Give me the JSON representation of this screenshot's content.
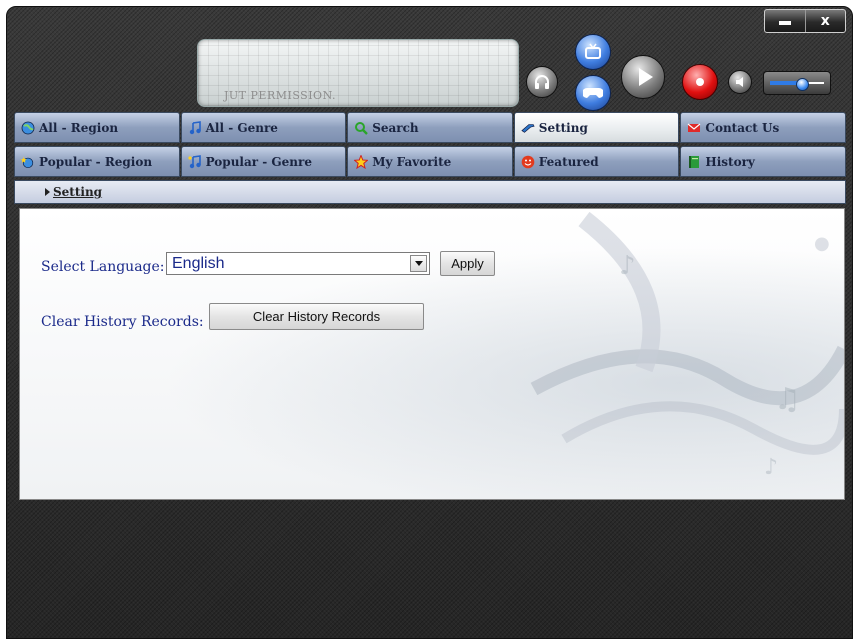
{
  "window": {
    "minimize_icon": "minimize-icon",
    "close_label": "x"
  },
  "banner": {
    "text": "JUT PERMISSION."
  },
  "player": {
    "volume_level": 0.6,
    "buttons": [
      "headphones-icon",
      "tv-icon",
      "gamepad-icon",
      "play-icon",
      "record-icon",
      "speaker-icon"
    ]
  },
  "tabs": {
    "row1": [
      {
        "label": "All - Region",
        "icon": "globe-icon"
      },
      {
        "label": "All - Genre",
        "icon": "music-note-icon"
      },
      {
        "label": "Search",
        "icon": "magnifier-icon"
      },
      {
        "label": "Setting",
        "icon": "wrench-icon",
        "active": true
      },
      {
        "label": "Contact Us",
        "icon": "envelope-icon"
      }
    ],
    "row2": [
      {
        "label": "Popular - Region",
        "icon": "globe-star-icon"
      },
      {
        "label": "Popular - Genre",
        "icon": "music-note-icon"
      },
      {
        "label": "My Favorite",
        "icon": "star-icon"
      },
      {
        "label": "Featured",
        "icon": "smiley-icon"
      },
      {
        "label": "History",
        "icon": "book-icon"
      }
    ]
  },
  "breadcrumb": {
    "current": "Setting"
  },
  "settings": {
    "language_label": "Select Language:",
    "language_value": "English",
    "apply_label": "Apply",
    "clear_label": "Clear History Records:",
    "clear_button": "Clear History Records"
  },
  "colors": {
    "accent_blue": "#2f7be6",
    "label_blue": "#1b2a8a",
    "record_red": "#e01010"
  }
}
